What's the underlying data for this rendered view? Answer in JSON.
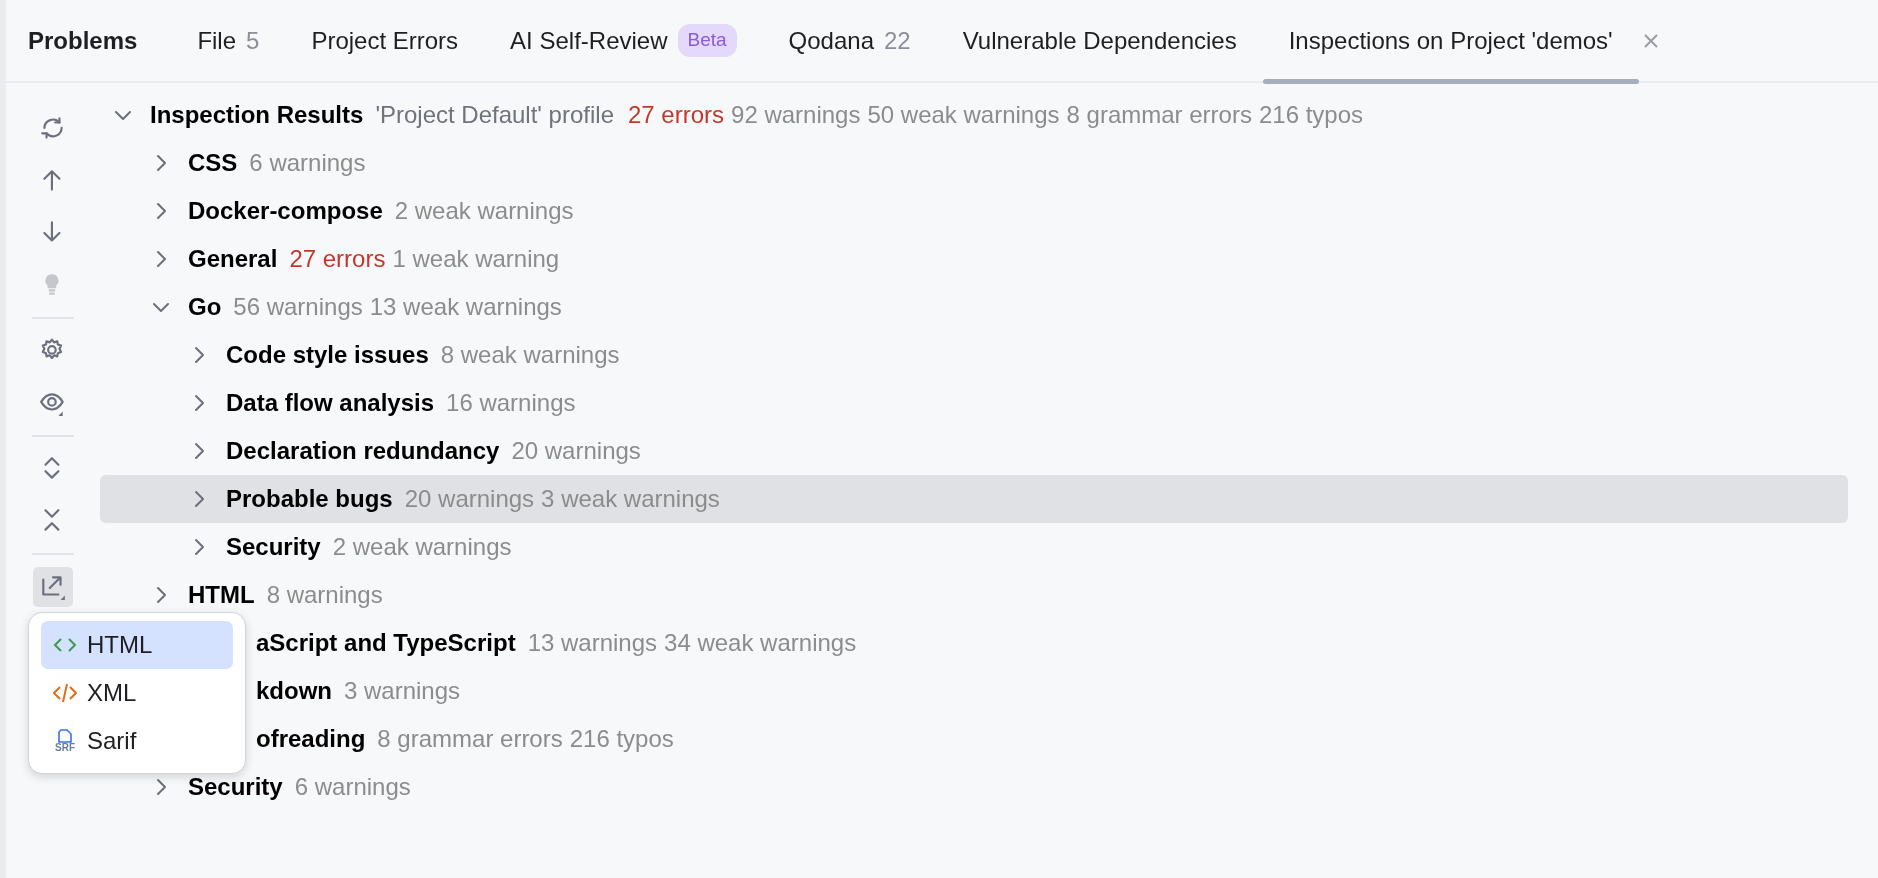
{
  "panel_title": "Problems",
  "tabs": [
    {
      "label": "File",
      "count": "5",
      "selected": false
    },
    {
      "label": "Project Errors",
      "selected": false
    },
    {
      "label": "AI Self-Review",
      "badge": "Beta",
      "selected": false
    },
    {
      "label": "Qodana",
      "count": "22",
      "selected": false
    },
    {
      "label": "Vulnerable Dependencies",
      "selected": false
    },
    {
      "label": "Inspections on Project 'demos'",
      "closable": true,
      "selected": true
    }
  ],
  "toolbar": [
    {
      "kind": "refresh",
      "disabled": false
    },
    {
      "kind": "up",
      "disabled": false
    },
    {
      "kind": "down",
      "disabled": false
    },
    {
      "kind": "bulb",
      "disabled": true
    },
    {
      "kind": "separator"
    },
    {
      "kind": "settings",
      "disabled": false
    },
    {
      "kind": "eye",
      "disabled": false
    },
    {
      "kind": "separator"
    },
    {
      "kind": "expand",
      "disabled": false
    },
    {
      "kind": "collapse",
      "disabled": false
    },
    {
      "kind": "separator"
    },
    {
      "kind": "export",
      "disabled": false,
      "pressed": true
    }
  ],
  "tree": [
    {
      "label": "Inspection Results",
      "profile": "'Project Default' profile",
      "expanded": true,
      "selected": false,
      "counts": [
        {
          "text": "27 errors",
          "kind": "error"
        },
        {
          "text": "92 warnings",
          "kind": "plain"
        },
        {
          "text": "50 weak warnings",
          "kind": "plain"
        },
        {
          "text": "8 grammar errors",
          "kind": "plain"
        },
        {
          "text": "216 typos",
          "kind": "plain"
        }
      ],
      "children": [
        {
          "label": "CSS",
          "expanded": false,
          "selected": false,
          "counts": [
            {
              "text": "6 warnings",
              "kind": "plain"
            }
          ]
        },
        {
          "label": "Docker-compose",
          "expanded": false,
          "selected": false,
          "counts": [
            {
              "text": "2 weak warnings",
              "kind": "plain"
            }
          ]
        },
        {
          "label": "General",
          "expanded": false,
          "selected": false,
          "counts": [
            {
              "text": "27 errors",
              "kind": "error"
            },
            {
              "text": "1 weak warning",
              "kind": "plain"
            }
          ]
        },
        {
          "label": "Go",
          "expanded": true,
          "selected": false,
          "counts": [
            {
              "text": "56 warnings",
              "kind": "plain"
            },
            {
              "text": "13 weak warnings",
              "kind": "plain"
            }
          ],
          "children": [
            {
              "label": "Code style issues",
              "expanded": false,
              "selected": false,
              "counts": [
                {
                  "text": "8 weak warnings",
                  "kind": "plain"
                }
              ]
            },
            {
              "label": "Data flow analysis",
              "expanded": false,
              "selected": false,
              "counts": [
                {
                  "text": "16 warnings",
                  "kind": "plain"
                }
              ]
            },
            {
              "label": "Declaration redundancy",
              "expanded": false,
              "selected": false,
              "counts": [
                {
                  "text": "20 warnings",
                  "kind": "plain"
                }
              ]
            },
            {
              "label": "Probable bugs",
              "expanded": false,
              "selected": true,
              "counts": [
                {
                  "text": "20 warnings",
                  "kind": "plain"
                },
                {
                  "text": "3 weak warnings",
                  "kind": "plain"
                }
              ]
            },
            {
              "label": "Security",
              "expanded": false,
              "selected": false,
              "counts": [
                {
                  "text": "2 weak warnings",
                  "kind": "plain"
                }
              ]
            }
          ]
        },
        {
          "label": "HTML",
          "expanded": false,
          "selected": false,
          "counts": [
            {
              "text": "8 warnings",
              "kind": "plain"
            }
          ]
        },
        {
          "label": "aScript and TypeScript",
          "covered": true,
          "selected": false,
          "counts": [
            {
              "text": "13 warnings",
              "kind": "plain"
            },
            {
              "text": "34 weak warnings",
              "kind": "plain"
            }
          ]
        },
        {
          "label": "kdown",
          "covered": true,
          "selected": false,
          "counts": [
            {
              "text": "3 warnings",
              "kind": "plain"
            }
          ]
        },
        {
          "label": "ofreading",
          "covered": true,
          "selected": false,
          "counts": [
            {
              "text": "8 grammar errors",
              "kind": "plain"
            },
            {
              "text": "216 typos",
              "kind": "plain"
            }
          ]
        },
        {
          "label": "Security",
          "expanded": false,
          "selected": false,
          "counts": [
            {
              "text": "6 warnings",
              "kind": "plain"
            }
          ]
        }
      ]
    }
  ],
  "export_menu": [
    {
      "label": "HTML",
      "kind": "html",
      "selected": true
    },
    {
      "label": "XML",
      "kind": "xml",
      "selected": false
    },
    {
      "label": "Sarif",
      "kind": "sarif",
      "icon_text": "SRF",
      "selected": false
    }
  ]
}
